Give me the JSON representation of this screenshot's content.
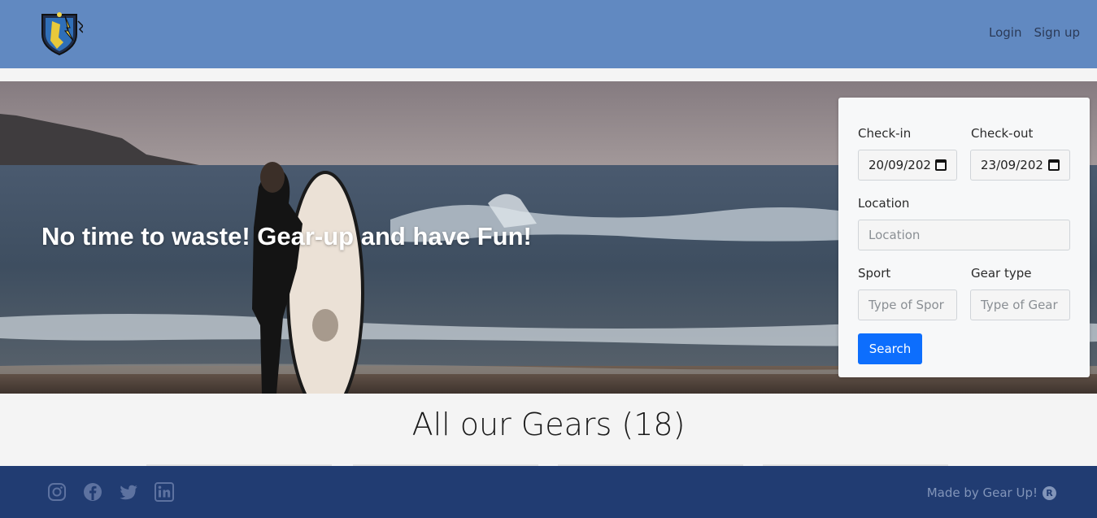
{
  "nav": {
    "logo_icon": "gear-up-shield-logo",
    "login": "Login",
    "signup": "Sign up"
  },
  "hero": {
    "tagline": "No time to waste! Gear-up and have Fun!",
    "image": "surfer-with-surfboard-on-beach"
  },
  "search": {
    "checkin_label": "Check-in",
    "checkin_value": "20/09/202",
    "checkout_label": "Check-out",
    "checkout_value": "23/09/202",
    "location_label": "Location",
    "location_placeholder": "Location",
    "sport_label": "Sport",
    "sport_placeholder": "Type of Spor",
    "gear_label": "Gear type",
    "gear_placeholder": "Type of Gear",
    "button": "Search"
  },
  "gears": {
    "title": "All our Gears (18)"
  },
  "footer": {
    "icons": [
      "instagram-icon",
      "facebook-icon",
      "twitter-icon",
      "linkedin-icon"
    ],
    "credit": "Made by Gear Up!",
    "reg_mark": "R"
  },
  "colors": {
    "navbar": "#6189c1",
    "footer": "#213c72",
    "button": "#0d6efd"
  }
}
